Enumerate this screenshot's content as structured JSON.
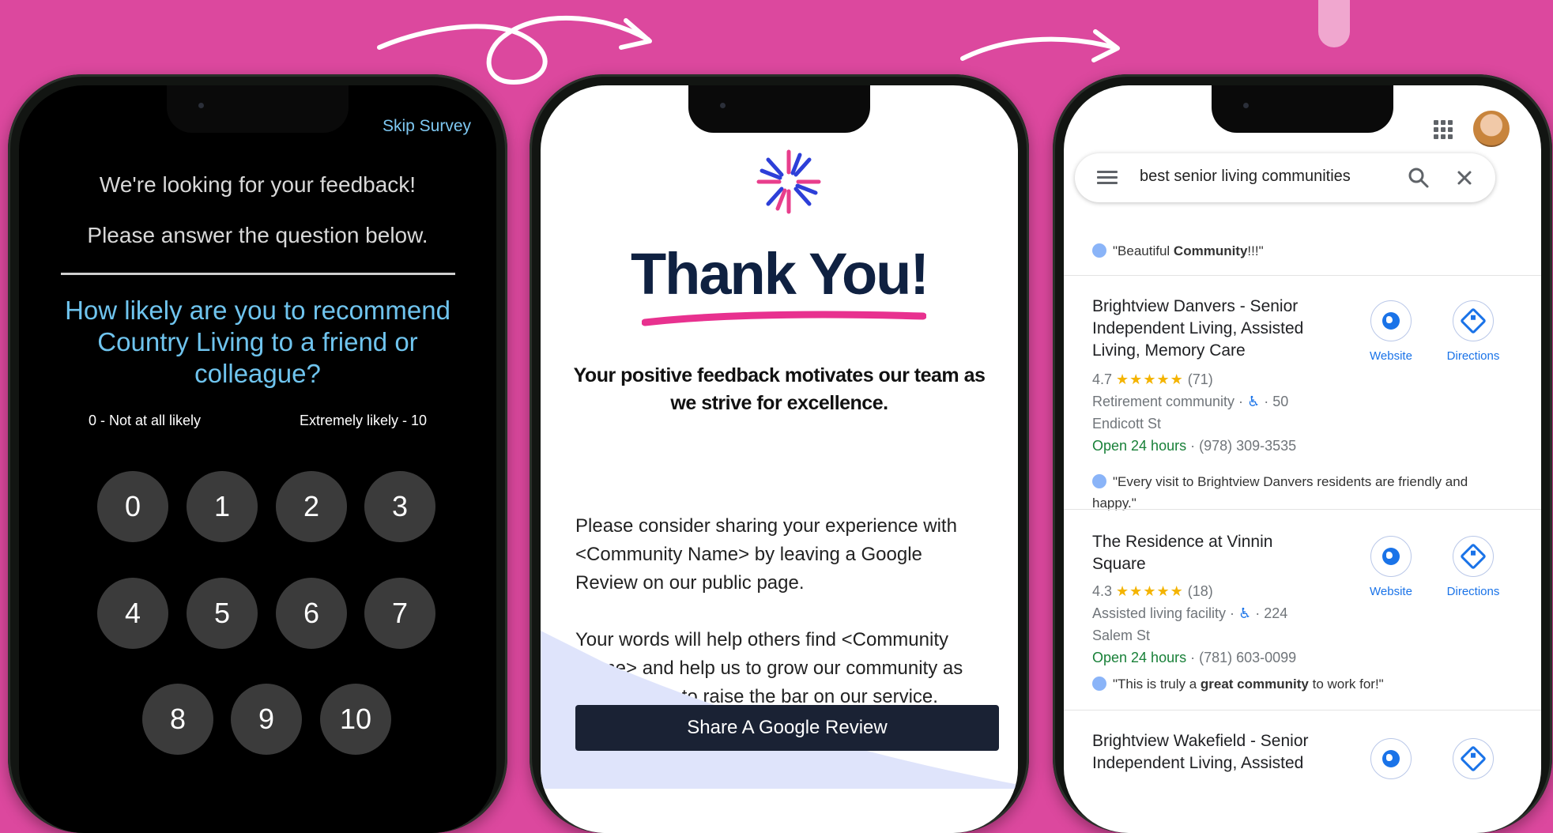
{
  "colors": {
    "background": "#dc489e",
    "accent_blue": "#1a73e8",
    "survey_blue": "#6fc4ee",
    "cta_dark": "#1a2234"
  },
  "survey": {
    "skip_label": "Skip Survey",
    "intro_line1": "We're looking for your feedback!",
    "intro_line2": "Please answer the question below.",
    "question": "How likely are you to recommend Country Living to a friend or colleague?",
    "scale_low_label": "0 - Not at all likely",
    "scale_high_label": "Extremely likely - 10",
    "options": [
      "0",
      "1",
      "2",
      "3",
      "4",
      "5",
      "6",
      "7",
      "8",
      "9",
      "10"
    ]
  },
  "thanks": {
    "title": "Thank You!",
    "lead": "Your positive feedback motivates our team as we strive for excellence.",
    "paragraph1": "Please consider sharing your experience with <Community Name> by leaving a Google Review on our public page.",
    "paragraph2": "Your words will help others find <Community Name> and help us to grow our community as we continue to raise the bar on our service.",
    "cta_label": "Share A Google Review"
  },
  "maps": {
    "search_query": "best senior living communities",
    "top_review_prefix": "\"Beautiful ",
    "top_review_bold": "Community",
    "top_review_suffix": "!!!\"",
    "website_label": "Website",
    "directions_label": "Directions",
    "icons": [
      "apps-grid-icon",
      "menu-icon",
      "search-icon",
      "close-icon",
      "globe-icon",
      "directions-icon",
      "wheelchair-icon"
    ],
    "listings": [
      {
        "name": "Brightview Danvers - Senior Independent Living, Assisted Living, Memory Care",
        "rating": "4.7",
        "stars": "★★★★★",
        "review_count": "(71)",
        "category": "Retirement community ·",
        "accessibility_count": "· 50",
        "address": "Endicott St",
        "hours": "Open 24 hours",
        "phone": "· (978) 309-3535",
        "review": "\"Every visit to Brightview Danvers residents are friendly and happy.\""
      },
      {
        "name": "The Residence at Vinnin Square",
        "rating": "4.3",
        "stars": "★★★★★",
        "review_count": "(18)",
        "category": "Assisted living facility ·",
        "accessibility_count": "· 224",
        "address": "Salem St",
        "hours": "Open 24 hours",
        "phone": "· (781) 603-0099",
        "review_prefix": "\"This is truly a ",
        "review_bold": "great community",
        "review_suffix": " to work for!\""
      },
      {
        "name": "Brightview Wakefield - Senior Independent Living, Assisted"
      }
    ]
  }
}
